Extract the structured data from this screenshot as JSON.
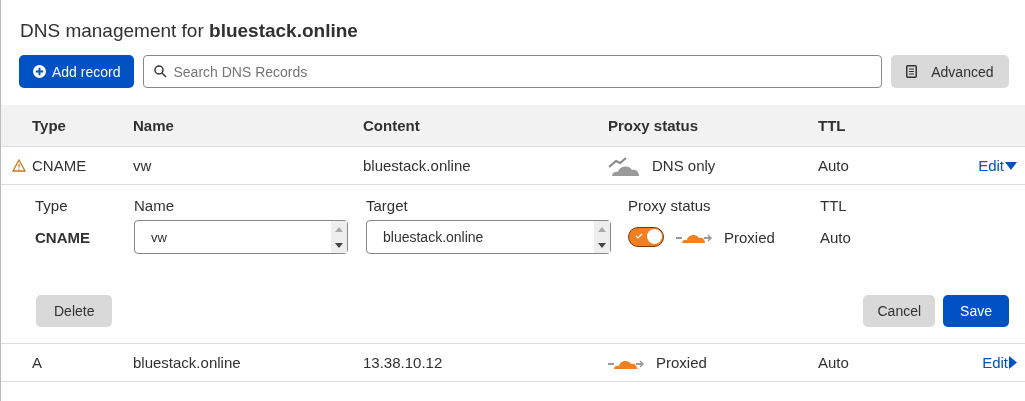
{
  "title": "DNS management for **bluestack.online**",
  "toolbar": {
    "add_button": "Add record",
    "search": {
      "placeholder": "Search DNS Records"
    },
    "advanced_button": "Advanced"
  },
  "table": {
    "columns": [
      "Type",
      "Name",
      "Content",
      "Proxy status",
      "TTL"
    ],
    "rows": [
      {
        "type": "CNAME",
        "warning": true,
        "name": "vw",
        "content": "bluestack.online",
        "proxied": false,
        "proxy_status": "DNS only",
        "ttl": "Auto",
        "edit": "Edit",
        "expanded": true,
        "editor": {
          "type_label": "Type",
          "type_value": "CNAME",
          "name_label": "Name",
          "name_value": "vw",
          "target_label": "Target",
          "target_value": "bluestack.online",
          "proxy_label": "Proxy status",
          "proxy_on": true,
          "proxy_text": "Proxied",
          "ttl_label": "TTL",
          "ttl_value": "Auto",
          "delete_button": "Delete",
          "cancel_button": "Cancel",
          "save_button": "Save"
        }
      },
      {
        "type": "A",
        "warning": false,
        "name": "bluestack.online",
        "content": "13.38.10.12",
        "proxied": true,
        "proxy_status": "Proxied",
        "ttl": "Auto",
        "edit": "Edit",
        "expanded": false
      }
    ]
  }
}
